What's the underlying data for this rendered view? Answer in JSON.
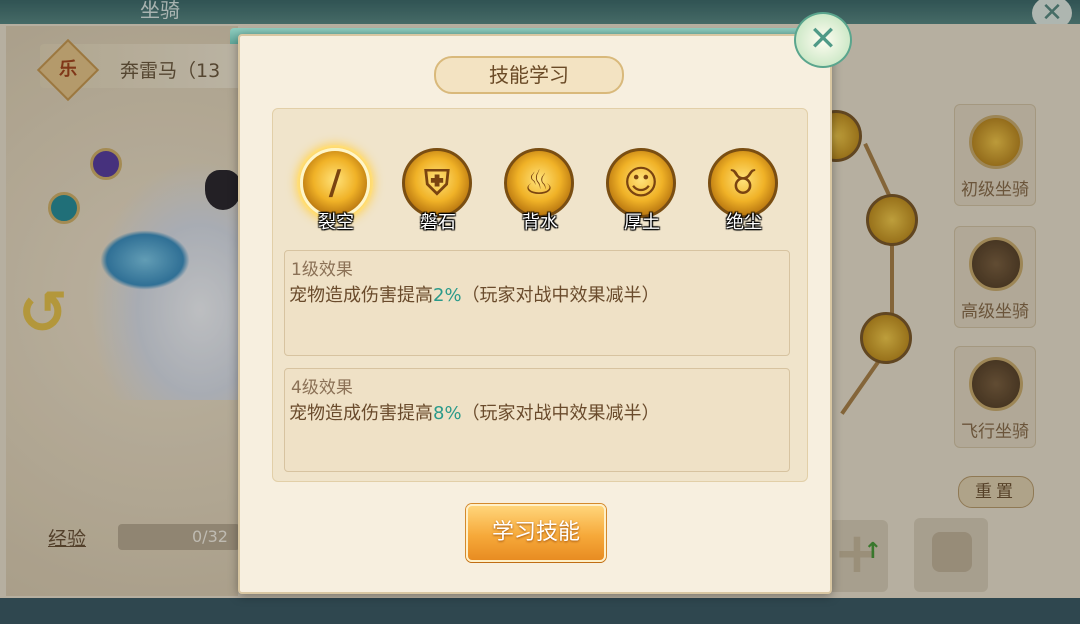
{
  "background": {
    "window_title": "坐骑",
    "mount_name": "奔雷马（13",
    "emblem_glyph": "乐",
    "exp_label": "经验",
    "exp_value": "0/32",
    "reset_label": "重置",
    "slots": [
      {
        "label": "初级坐骑"
      },
      {
        "label": "高级坐骑"
      },
      {
        "label": "飞行坐骑"
      }
    ]
  },
  "dialog": {
    "title": "技能学习",
    "close_icon": "close-icon",
    "skills": [
      {
        "label": "裂空",
        "icon": "slash-icon",
        "selected": true
      },
      {
        "label": "磐石",
        "icon": "shield-icon",
        "selected": false
      },
      {
        "label": "背水",
        "icon": "flame-figure-icon",
        "selected": false
      },
      {
        "label": "厚土",
        "icon": "shield-figure-icon",
        "selected": false
      },
      {
        "label": "绝尘",
        "icon": "horned-beast-icon",
        "selected": false
      }
    ],
    "effects": [
      {
        "level_label": "1级效果",
        "desc_prefix": "宠物造成伤害提高",
        "percent": "2%",
        "desc_suffix": "（玩家对战中效果减半）"
      },
      {
        "level_label": "4级效果",
        "desc_prefix": "宠物造成伤害提高",
        "percent": "8%",
        "desc_suffix": "（玩家对战中效果减半）"
      }
    ],
    "learn_button": "学习技能"
  },
  "colors": {
    "accent_teal": "#2a9a8a",
    "button_orange": "#f6a93a",
    "gold": "#f0b227"
  }
}
